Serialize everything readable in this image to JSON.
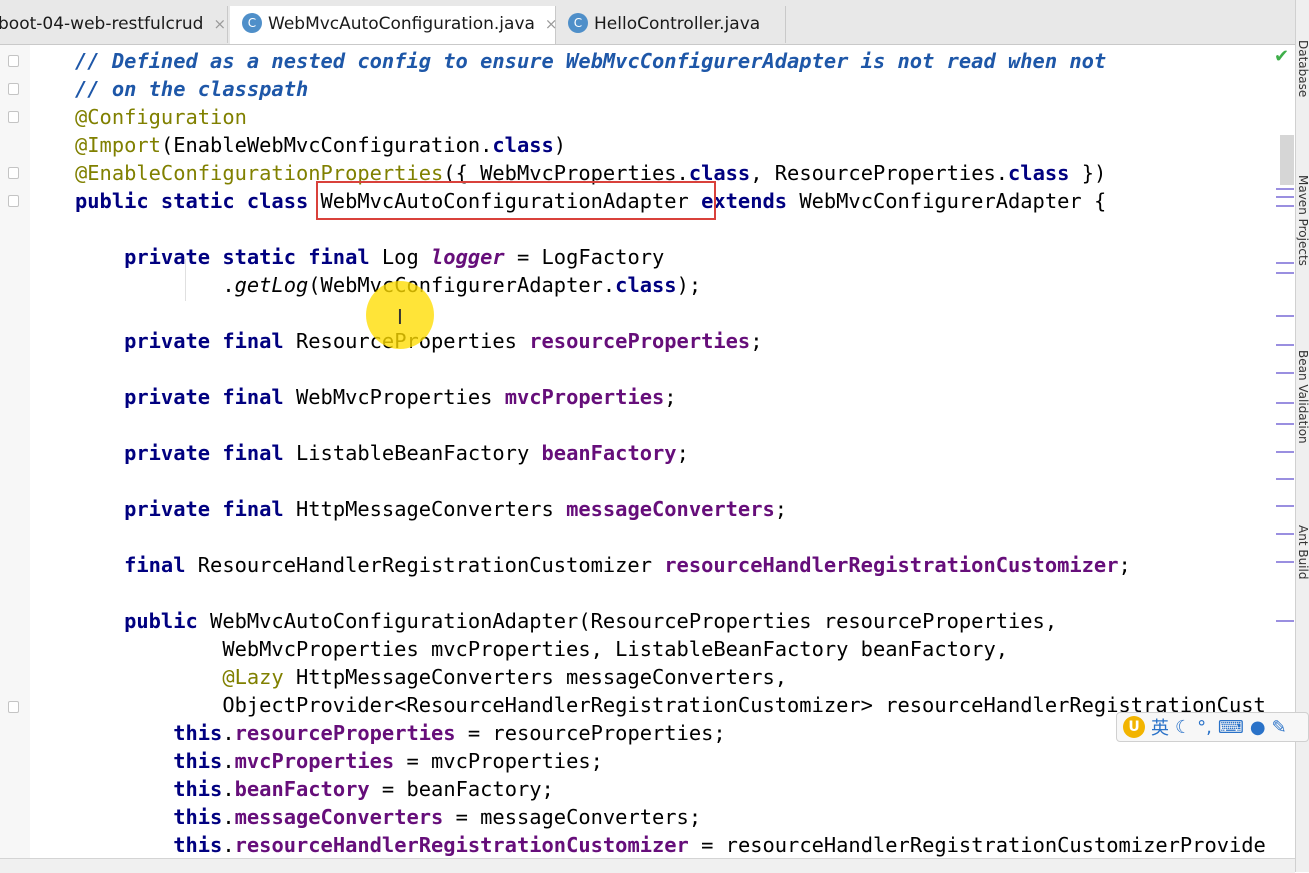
{
  "tabs": [
    {
      "label": "boot-04-web-restfulcrud",
      "active": false,
      "icon": "none"
    },
    {
      "label": "WebMvcAutoConfiguration.java",
      "active": true,
      "icon": "class-c-icon"
    },
    {
      "label": "HelloController.java",
      "active": false,
      "icon": "class-c-icon"
    }
  ],
  "tab_close_glyph": "×",
  "class_icon_glyph": "C",
  "code_lines": [
    [
      [
        "cm",
        "// Defined as a nested config to ensure WebMvcConfigurerAdapter is not read when not"
      ]
    ],
    [
      [
        "cm",
        "// on the classpath"
      ]
    ],
    [
      [
        "an",
        "@Configuration"
      ]
    ],
    [
      [
        "an",
        "@Import"
      ],
      [
        "",
        "(EnableWebMvcConfiguration."
      ],
      [
        "kw",
        "class"
      ],
      [
        "",
        ")"
      ]
    ],
    [
      [
        "an",
        "@EnableConfigurationProperties"
      ],
      [
        "",
        "({ WebMvcProperties."
      ],
      [
        "kw",
        "class"
      ],
      [
        "",
        ", ResourceProperties."
      ],
      [
        "kw",
        "class"
      ],
      [
        "",
        " })"
      ]
    ],
    [
      [
        "kw",
        "public static class "
      ],
      [
        "",
        "WebMvcAutoConfigurationAdapter "
      ],
      [
        "kw",
        "extends "
      ],
      [
        "",
        "WebMvcConfigurerAdapter {"
      ]
    ],
    [],
    [
      [
        "kw",
        "    private static final "
      ],
      [
        "",
        "Log "
      ],
      [
        "itf",
        "logger"
      ],
      [
        "",
        " = LogFactory"
      ]
    ],
    [
      [
        "",
        "            ."
      ],
      [
        "it",
        "getLog"
      ],
      [
        "",
        "(WebMvcConfigurerAdapter."
      ],
      [
        "kw",
        "class"
      ],
      [
        "",
        ");"
      ]
    ],
    [],
    [
      [
        "kw",
        "    private final "
      ],
      [
        "",
        "ResourceProperties "
      ],
      [
        "fd",
        "resourceProperties"
      ],
      [
        "",
        ";"
      ]
    ],
    [],
    [
      [
        "kw",
        "    private final "
      ],
      [
        "",
        "WebMvcProperties "
      ],
      [
        "fd",
        "mvcProperties"
      ],
      [
        "",
        ";"
      ]
    ],
    [],
    [
      [
        "kw",
        "    private final "
      ],
      [
        "",
        "ListableBeanFactory "
      ],
      [
        "fd",
        "beanFactory"
      ],
      [
        "",
        ";"
      ]
    ],
    [],
    [
      [
        "kw",
        "    private final "
      ],
      [
        "",
        "HttpMessageConverters "
      ],
      [
        "fd",
        "messageConverters"
      ],
      [
        "",
        ";"
      ]
    ],
    [],
    [
      [
        "kw",
        "    final "
      ],
      [
        "",
        "ResourceHandlerRegistrationCustomizer "
      ],
      [
        "fd",
        "resourceHandlerRegistrationCustomizer"
      ],
      [
        "",
        ";"
      ]
    ],
    [],
    [
      [
        "kw",
        "    public "
      ],
      [
        "",
        "WebMvcAutoConfigurationAdapter(ResourceProperties resourceProperties,"
      ]
    ],
    [
      [
        "",
        "            WebMvcProperties mvcProperties, ListableBeanFactory beanFactory,"
      ]
    ],
    [
      [
        "an",
        "            @Lazy "
      ],
      [
        "",
        "HttpMessageConverters messageConverters,"
      ]
    ],
    [
      [
        "",
        "            ObjectProvider<ResourceHandlerRegistrationCustomizer> resourceHandlerRegistrationCust"
      ]
    ],
    [
      [
        "kw",
        "        this"
      ],
      [
        "",
        "."
      ],
      [
        "fd",
        "resourceProperties"
      ],
      [
        "",
        " = resourceProperties;"
      ]
    ],
    [
      [
        "kw",
        "        this"
      ],
      [
        "",
        "."
      ],
      [
        "fd",
        "mvcProperties"
      ],
      [
        "",
        " = mvcProperties;"
      ]
    ],
    [
      [
        "kw",
        "        this"
      ],
      [
        "",
        "."
      ],
      [
        "fd",
        "beanFactory"
      ],
      [
        "",
        " = beanFactory;"
      ]
    ],
    [
      [
        "kw",
        "        this"
      ],
      [
        "",
        "."
      ],
      [
        "fd",
        "messageConverters"
      ],
      [
        "",
        " = messageConverters;"
      ]
    ],
    [
      [
        "kw",
        "        this"
      ],
      [
        "",
        "."
      ],
      [
        "fd",
        "resourceHandlerRegistrationCustomizer"
      ],
      [
        "",
        " = resourceHandlerRegistrationCustomizerProvide"
      ]
    ]
  ],
  "right_tool_windows": [
    "Database",
    "Maven Projects",
    "Bean Validation",
    "Ant Build"
  ],
  "ime_bar": {
    "language": "英",
    "items": [
      "moon-icon",
      "punctuation-icon",
      "keyboard-icon",
      "user-icon",
      "wrench-icon"
    ]
  },
  "colors": {
    "keyword": "#000080",
    "comment": "#1e57a8",
    "annotation": "#808000",
    "field": "#660e7a",
    "highlight_box": "#d9413b",
    "cursor_highlight": "#ffdd00"
  }
}
